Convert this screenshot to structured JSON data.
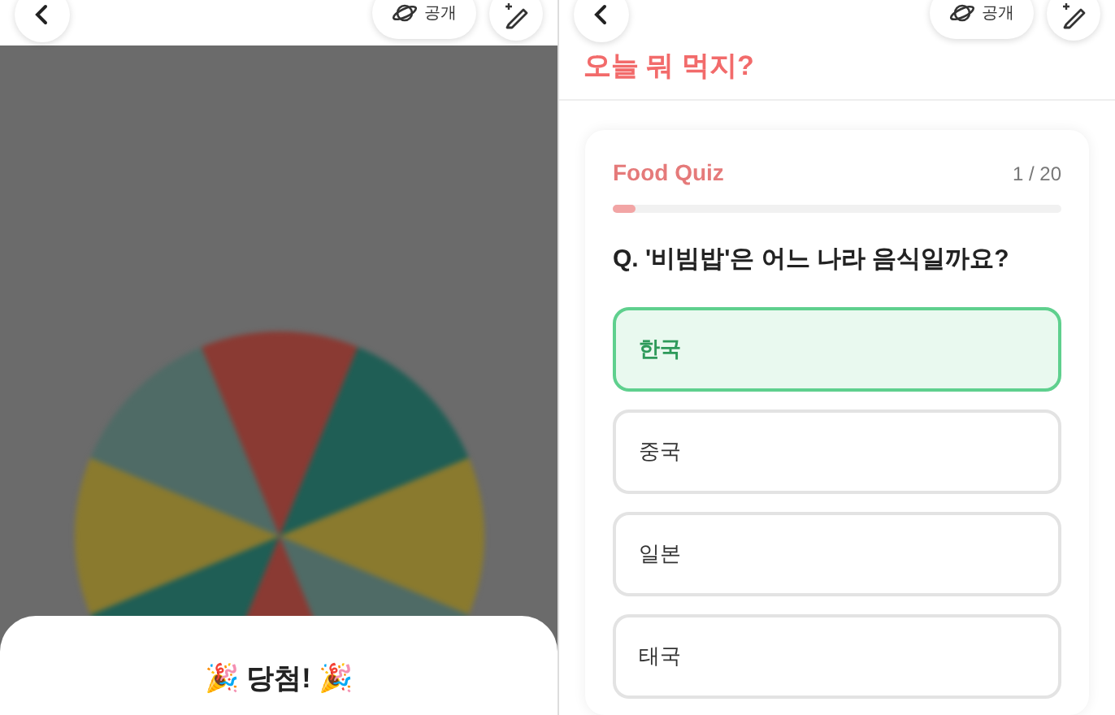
{
  "left_screen": {
    "header": {
      "visibility_label": "공개"
    },
    "result_sheet": {
      "title": "🎉 당첨! 🎉"
    }
  },
  "right_screen": {
    "header": {
      "visibility_label": "공개"
    },
    "page_title": "오늘 뭐 먹지?",
    "quiz": {
      "title": "Food Quiz",
      "counter": "1 / 20",
      "progress": {
        "level": 0.05
      },
      "question": "Q. '비빔밥'은 어느 나라 음식일까요?",
      "options": [
        {
          "label": "한국",
          "selected": true
        },
        {
          "label": "중국",
          "selected": false
        },
        {
          "label": "일본",
          "selected": false
        },
        {
          "label": "태국",
          "selected": false
        }
      ]
    }
  }
}
